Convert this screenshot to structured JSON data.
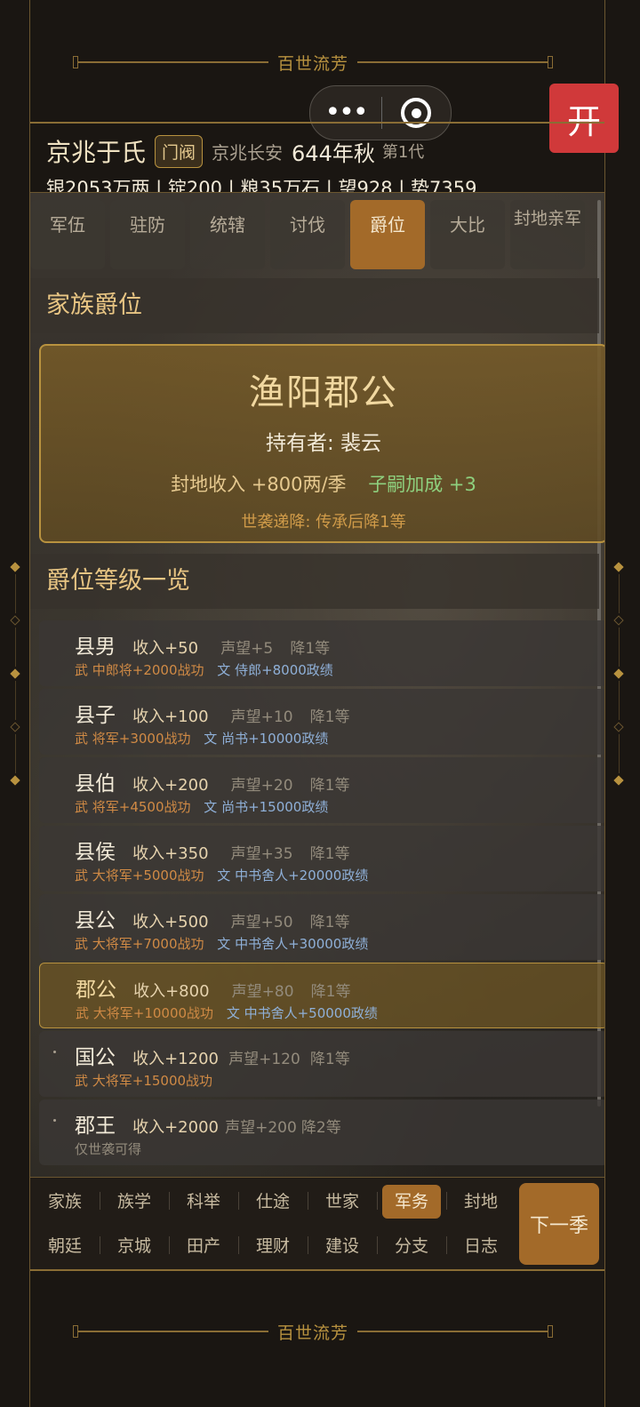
{
  "banner_text": "百世流芳",
  "capsule": {
    "dots": "•••"
  },
  "open_button": "开",
  "header": {
    "family_name": "京兆于氏",
    "family_tag": "门阀",
    "location": "京兆长安",
    "date": "644年秋",
    "generation": "第1代",
    "resources": "银2053万两 | 锭200 | 粮35万石 | 望928 | 势7359"
  },
  "tabs": [
    {
      "label": "军伍"
    },
    {
      "label": "驻防"
    },
    {
      "label": "统辖"
    },
    {
      "label": "讨伐"
    },
    {
      "label": "爵位",
      "active": true
    },
    {
      "label": "大比"
    },
    {
      "label": "封地亲军"
    }
  ],
  "family_title_section": {
    "heading": "家族爵位",
    "title": "渔阳郡公",
    "holder": "持有者: 裴云",
    "income": "封地收入 +800两/季",
    "bonus": "子嗣加成 +3",
    "decay": "世袭递降: 传承后降1等"
  },
  "rank_list": {
    "heading": "爵位等级一览",
    "items": [
      {
        "name": "县男",
        "income": "收入+50",
        "fame": "声望+5",
        "decay": "降1等",
        "mil": "武 中郎将+2000战功",
        "civ": "文 侍郎+8000政绩"
      },
      {
        "name": "县子",
        "income": "收入+100",
        "fame": "声望+10",
        "decay": "降1等",
        "mil": "武 将军+3000战功",
        "civ": "文 尚书+10000政绩"
      },
      {
        "name": "县伯",
        "income": "收入+200",
        "fame": "声望+20",
        "decay": "降1等",
        "mil": "武 将军+4500战功",
        "civ": "文 尚书+15000政绩"
      },
      {
        "name": "县侯",
        "income": "收入+350",
        "fame": "声望+35",
        "decay": "降1等",
        "mil": "武 大将军+5000战功",
        "civ": "文 中书舍人+20000政绩"
      },
      {
        "name": "县公",
        "income": "收入+500",
        "fame": "声望+50",
        "decay": "降1等",
        "mil": "武 大将军+7000战功",
        "civ": "文 中书舍人+30000政绩"
      },
      {
        "name": "郡公",
        "income": "收入+800",
        "fame": "声望+80",
        "decay": "降1等",
        "mil": "武 大将军+10000战功",
        "civ": "文 中书舍人+50000政绩",
        "current": true
      },
      {
        "name": "国公",
        "income": "收入+1200",
        "fame": "声望+120",
        "decay": "降1等",
        "mil": "武 大将军+15000战功",
        "civ": ""
      },
      {
        "name": "郡王",
        "income": "收入+2000",
        "fame": "声望+200",
        "decay": "降2等",
        "note": "仅世袭可得"
      }
    ]
  },
  "bottom_nav": {
    "row1": [
      "家族",
      "族学",
      "科举",
      "仕途",
      "世家",
      "军务",
      "封地"
    ],
    "row2": [
      "朝廷",
      "京城",
      "田产",
      "理财",
      "建设",
      "分支",
      "日志"
    ],
    "active": "军务",
    "next_button": "下一季"
  },
  "colors": {
    "gold": "#b8923f",
    "active_tab": "#a36a29",
    "bonus_green": "#8ed07e",
    "open_red": "#d0393a"
  }
}
